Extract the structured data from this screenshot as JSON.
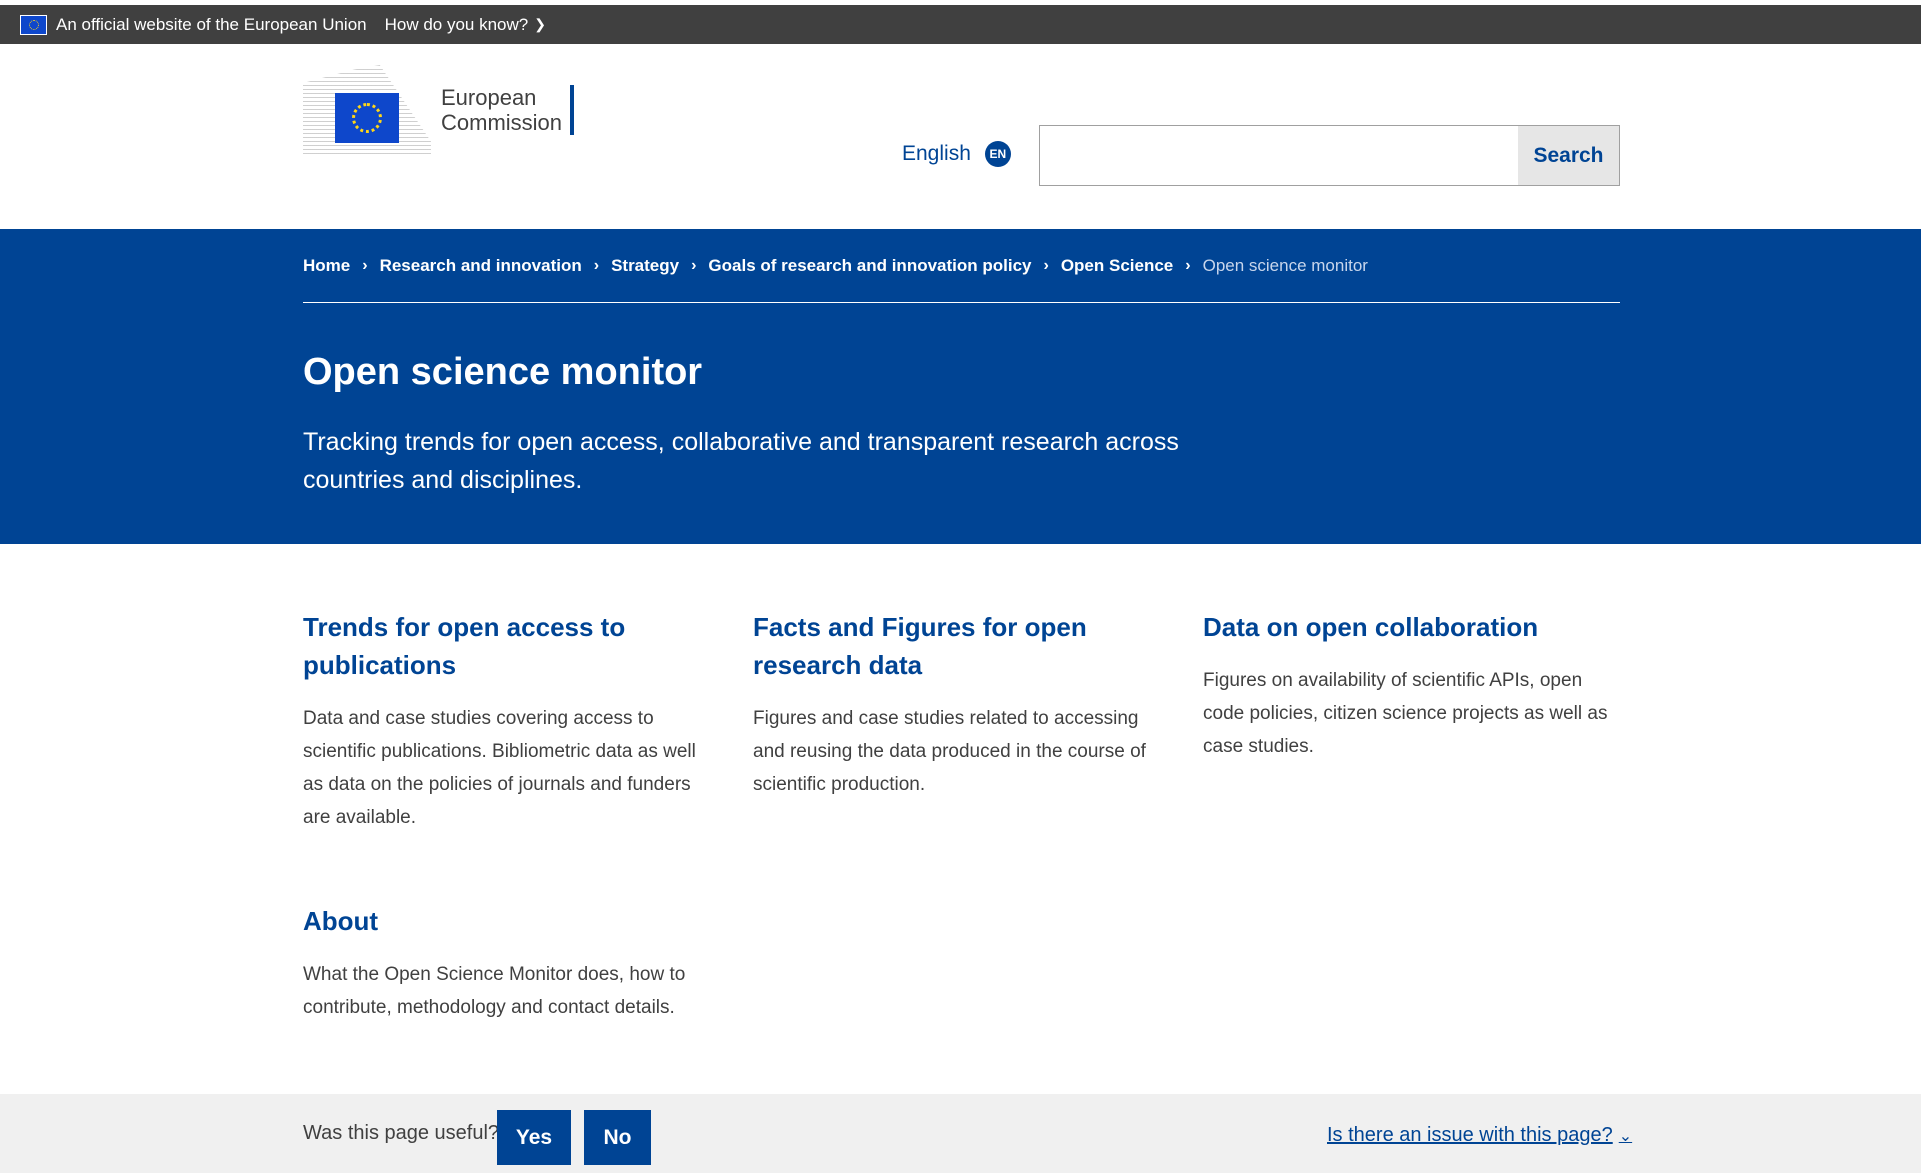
{
  "topbar": {
    "official_text": "An official website of the European Union",
    "how_know": "How do you know?"
  },
  "header": {
    "logo_line1": "European",
    "logo_line2": "Commission",
    "language": "English",
    "language_code": "EN",
    "search_placeholder": "",
    "search_button": "Search"
  },
  "breadcrumb": [
    "Home",
    "Research and innovation",
    "Strategy",
    "Goals of research and innovation policy",
    "Open Science",
    "Open science monitor"
  ],
  "page": {
    "title": "Open science monitor",
    "subtitle": "Tracking trends for open access, collaborative and transparent research across countries and disciplines."
  },
  "cards": [
    {
      "title": "Trends for open access to publications",
      "text": "Data and case studies covering access to scientific publications. Bibliometric data as well as data on the policies of journals and funders are available."
    },
    {
      "title": "Facts and Figures for open research data",
      "text": "Figures and case studies related to accessing and reusing the data produced in the course of scientific production."
    },
    {
      "title": "Data on open collaboration",
      "text": "Figures on availability of scientific APIs, open code policies, citizen science projects as well as case studies."
    },
    {
      "title": "About",
      "text": "What the Open Science Monitor does, how to contribute, methodology and contact details."
    }
  ],
  "feedback": {
    "question": "Was this page useful?",
    "yes": "Yes",
    "no": "No",
    "issue": "Is there an issue with this page?"
  },
  "colors": {
    "brand_blue": "#004494",
    "topbar": "#404040",
    "feedback_bg": "#f0f0f0"
  }
}
